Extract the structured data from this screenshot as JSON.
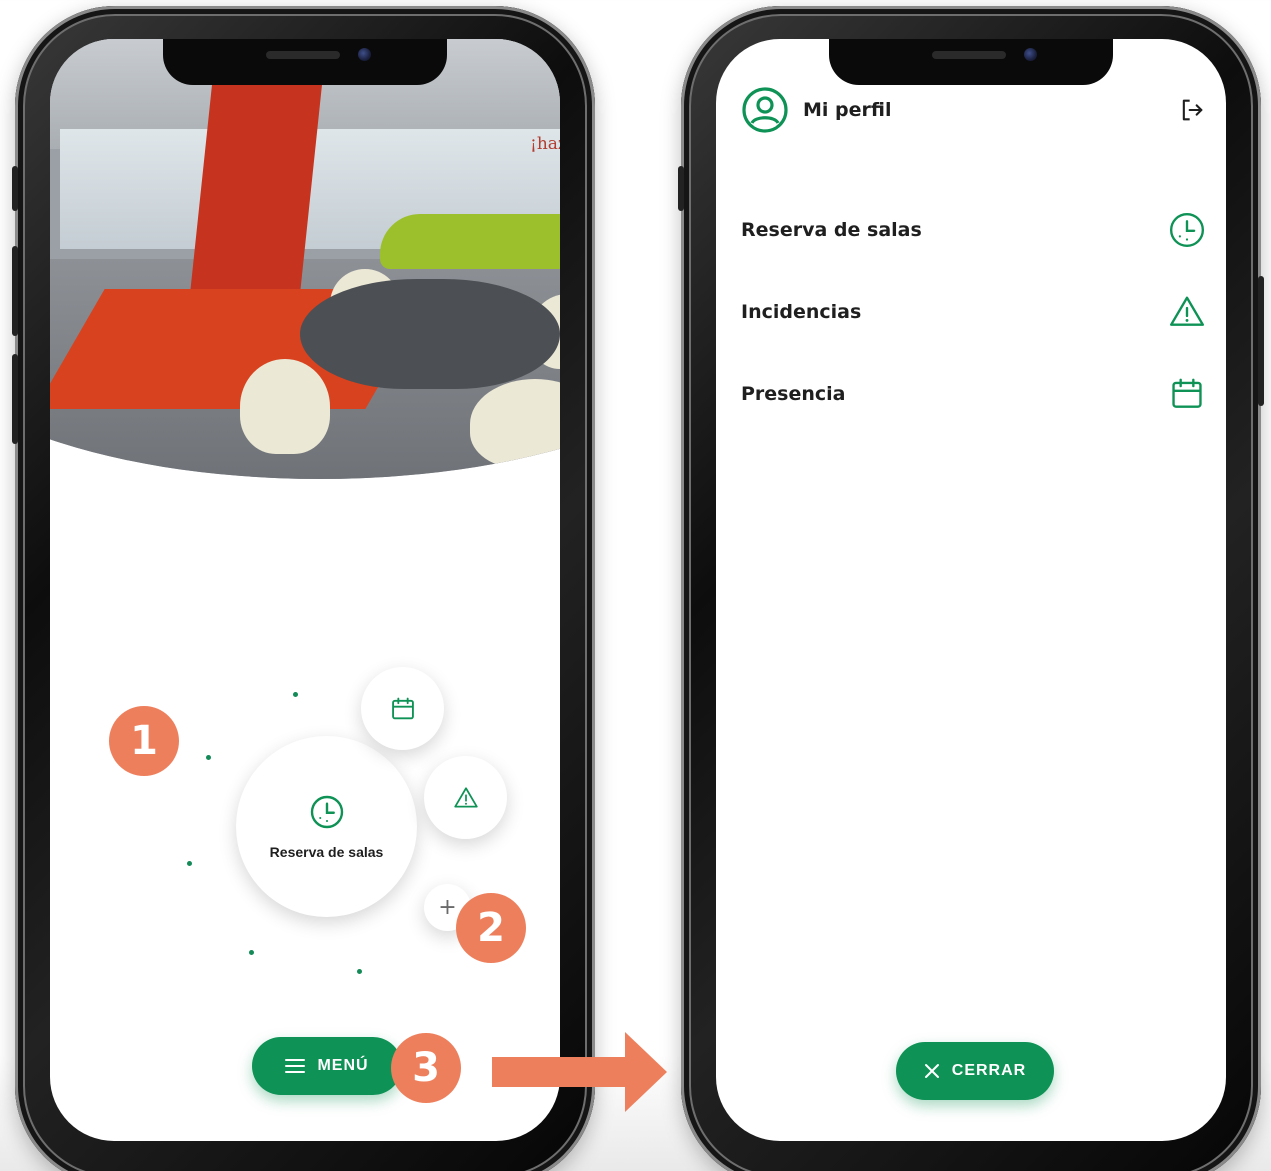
{
  "left_phone": {
    "photo_sign": "¡hazlo!",
    "bubble_main": {
      "label": "Reserva de salas",
      "icon": "clock-icon"
    },
    "bubble_secondary": [
      {
        "icon": "calendar-icon"
      },
      {
        "icon": "warning-icon"
      },
      {
        "icon": "plus-icon",
        "glyph": "+"
      }
    ],
    "menu_button": {
      "label": "MENÚ",
      "icon": "hamburger-icon"
    }
  },
  "right_phone": {
    "profile": {
      "label": "Mi perfil",
      "icon": "user-circle-icon",
      "logout_icon": "logout-icon"
    },
    "menu_items": [
      {
        "label": "Reserva de salas",
        "icon": "clock-icon"
      },
      {
        "label": "Incidencias",
        "icon": "warning-icon"
      },
      {
        "label": "Presencia",
        "icon": "calendar-icon"
      }
    ],
    "close_button": {
      "label": "CERRAR",
      "icon": "close-icon"
    }
  },
  "annotations": {
    "badges": [
      "1",
      "2",
      "3"
    ],
    "arrow": "right-arrow"
  },
  "colors": {
    "accent_green": "#0e9255",
    "badge_orange": "#ee7f5c",
    "text_dark": "#1f1f1f"
  }
}
